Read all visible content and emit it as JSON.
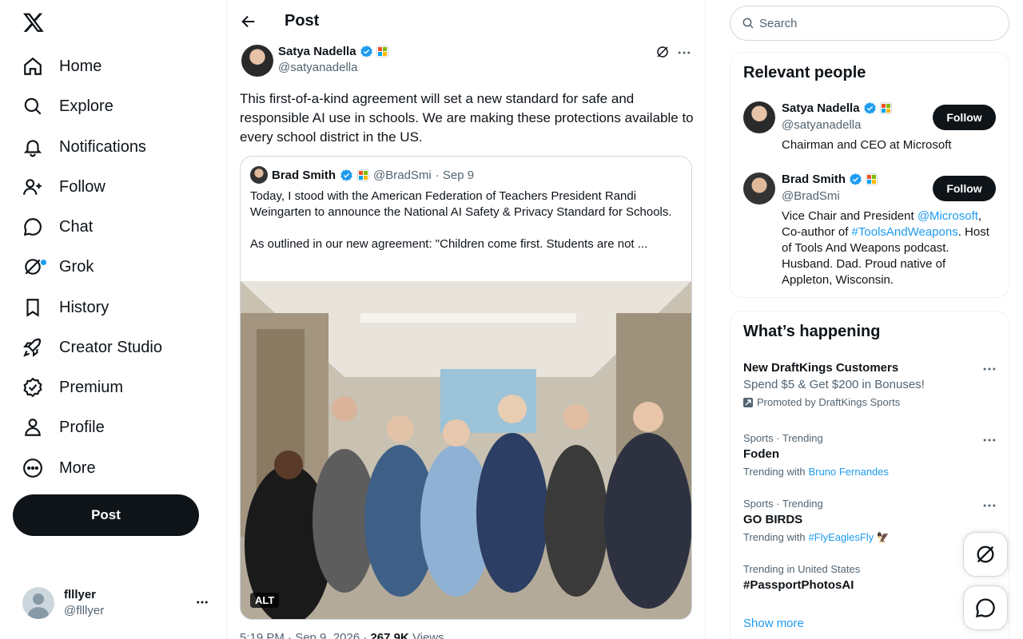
{
  "nav": {
    "items": [
      {
        "label": "Home",
        "icon": "home-icon"
      },
      {
        "label": "Explore",
        "icon": "search-icon"
      },
      {
        "label": "Notifications",
        "icon": "bell-icon"
      },
      {
        "label": "Follow",
        "icon": "add-user-icon"
      },
      {
        "label": "Chat",
        "icon": "chat-icon"
      },
      {
        "label": "Grok",
        "icon": "grok-icon"
      },
      {
        "label": "History",
        "icon": "bookmark-icon"
      },
      {
        "label": "Creator Studio",
        "icon": "rocket-icon"
      },
      {
        "label": "Premium",
        "icon": "verified-badge-icon"
      },
      {
        "label": "Profile",
        "icon": "person-icon"
      },
      {
        "label": "More",
        "icon": "more-circle-icon"
      }
    ],
    "post_label": "Post"
  },
  "account": {
    "name": "flllyer",
    "handle": "@flllyer"
  },
  "header": {
    "title": "Post"
  },
  "post": {
    "author_name": "Satya Nadella",
    "author_handle": "@satyanadella",
    "text": "This first-of-a-kind agreement will set a new standard for safe and responsible AI use in schools. We are making these protections available to every school district in the US.",
    "quote": {
      "author_name": "Brad Smith",
      "author_handle": "@BradSmi",
      "date": "· Sep 9",
      "text": "Today, I stood with the American Federation of Teachers President Randi Weingarten to announce the National AI Safety & Privacy Standard for Schools.\n\nAs outlined in our new agreement: \"Children come first. Students are not ...",
      "alt_label": "ALT"
    },
    "meta_time": "5:19 PM · Sep 9, 2026 ·",
    "meta_views": "267.9K",
    "meta_views_label": "Views"
  },
  "search": {
    "placeholder": "Search"
  },
  "relevant": {
    "title": "Relevant people",
    "follow_label": "Follow",
    "people": [
      {
        "name": "Satya Nadella",
        "handle": "@satyanadella",
        "bio": "Chairman and CEO at Microsoft"
      },
      {
        "name": "Brad Smith",
        "handle": "@BradSmi",
        "bio_pre": "Vice Chair and President ",
        "bio_link1": "@Microsoft",
        "bio_mid": ", Co-author of ",
        "bio_link2": "#ToolsAndWeapons",
        "bio_post": ". Host of Tools And Weapons podcast. Husband. Dad. Proud native of Appleton, Wisconsin."
      }
    ]
  },
  "happening": {
    "title": "What’s happening",
    "trends": [
      {
        "title": "New DraftKings Customers",
        "sub": "Spend $5 & Get $200 in Bonuses!",
        "promo": "Promoted by DraftKings Sports"
      },
      {
        "meta": "Sports · Trending",
        "title": "Foden",
        "with_label": "Trending with",
        "with_link": "Bruno Fernandes"
      },
      {
        "meta": "Sports · Trending",
        "title": "GO BIRDS",
        "with_label": "Trending with",
        "with_link": "#FlyEaglesFly"
      },
      {
        "meta": "Trending in United States",
        "title": "#PassportPhotosAI"
      }
    ],
    "show_more": "Show more"
  },
  "colors": {
    "accent": "#1d9bf0",
    "text": "#0f1419",
    "muted": "#536471"
  }
}
